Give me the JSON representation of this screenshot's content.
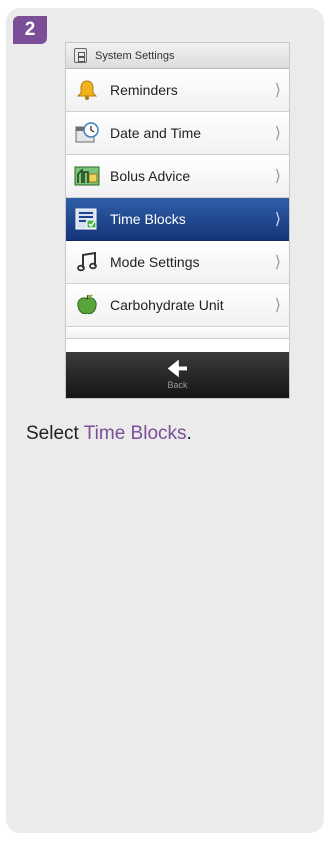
{
  "step": {
    "number": "2"
  },
  "screen": {
    "header": {
      "title": "System Settings",
      "icon": "settings-panel-icon"
    },
    "items": [
      {
        "label": "Reminders",
        "icon": "bell-icon",
        "selected": false
      },
      {
        "label": "Date and Time",
        "icon": "clock-icon",
        "selected": false
      },
      {
        "label": "Bolus Advice",
        "icon": "bolus-advice-icon",
        "selected": false
      },
      {
        "label": "Time Blocks",
        "icon": "time-blocks-icon",
        "selected": true
      },
      {
        "label": "Mode Settings",
        "icon": "music-note-icon",
        "selected": false
      },
      {
        "label": "Carbohydrate Unit",
        "icon": "apple-icon",
        "selected": false
      }
    ],
    "footer": {
      "back_label": "Back"
    }
  },
  "instruction": {
    "prefix": "Select ",
    "highlight": "Time Blocks",
    "suffix": "."
  },
  "colors": {
    "accent": "#7a4f97",
    "selected": "#1f448c"
  }
}
